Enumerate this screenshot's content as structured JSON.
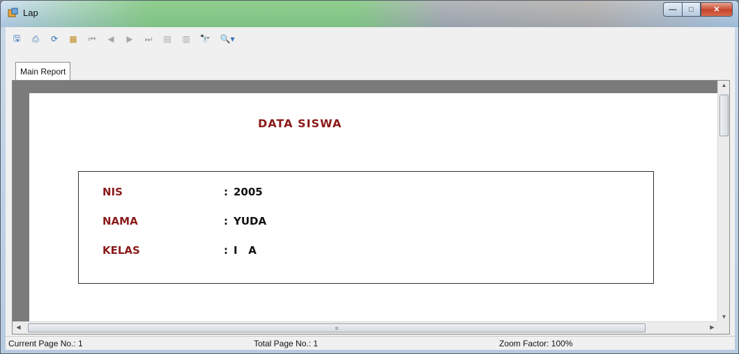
{
  "window": {
    "title": "Lap",
    "minimize": "—",
    "maximize": "□",
    "close": "✕"
  },
  "toolbar": {
    "buttons": [
      {
        "name": "export-icon",
        "glyph": "🖫",
        "enabled": true
      },
      {
        "name": "print-icon",
        "glyph": "⎙",
        "enabled": true
      },
      {
        "name": "refresh-icon",
        "glyph": "⟳",
        "enabled": true
      },
      {
        "name": "group-tree-icon",
        "glyph": "▦",
        "enabled": true
      },
      {
        "name": "first-page-icon",
        "glyph": "⏮",
        "enabled": false
      },
      {
        "name": "previous-page-icon",
        "glyph": "◀",
        "enabled": false
      },
      {
        "name": "next-page-icon",
        "glyph": "▶",
        "enabled": false
      },
      {
        "name": "last-page-icon",
        "glyph": "⏭",
        "enabled": false
      },
      {
        "name": "goto-page-icon",
        "glyph": "▤",
        "enabled": false
      },
      {
        "name": "close-view-icon",
        "glyph": "▥",
        "enabled": false
      },
      {
        "name": "find-icon",
        "glyph": "🔭",
        "enabled": true
      },
      {
        "name": "zoom-icon",
        "glyph": "🔍▾",
        "enabled": true
      }
    ]
  },
  "tab": {
    "label": "Main Report"
  },
  "report": {
    "title": "DATA SISWA",
    "fields": [
      {
        "label": "NIS",
        "colon": ":",
        "value": "2005"
      },
      {
        "label": "NAMA",
        "colon": ":",
        "value": "YUDA"
      },
      {
        "label": "KELAS",
        "colon": ":",
        "value": "I   A"
      }
    ]
  },
  "status": {
    "current_page": "Current Page No.: 1",
    "total_page": "Total Page No.: 1",
    "zoom": "Zoom Factor: 100%"
  },
  "colors": {
    "label_color": "#8b1a1a",
    "close_button": "#c6462b"
  }
}
